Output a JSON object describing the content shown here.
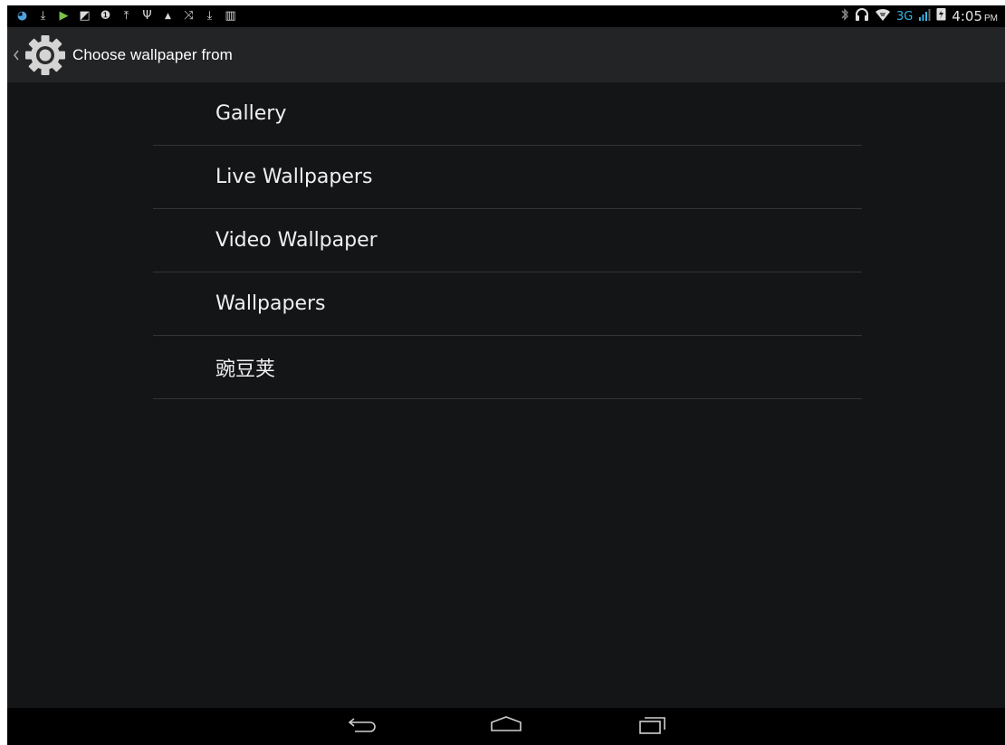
{
  "status_bar": {
    "left_icons": [
      {
        "name": "notification-app-icon",
        "glyph": "◕"
      },
      {
        "name": "download-icon",
        "glyph": "⤓"
      },
      {
        "name": "play-store-icon",
        "glyph": "▶"
      },
      {
        "name": "image-icon",
        "glyph": "◩"
      },
      {
        "name": "alert-icon",
        "glyph": "❶"
      },
      {
        "name": "upload-icon",
        "glyph": "⤒"
      },
      {
        "name": "usb-icon",
        "glyph": "Ψ"
      },
      {
        "name": "lock-icon",
        "glyph": "▲"
      },
      {
        "name": "missed-call-icon",
        "glyph": "⤨"
      },
      {
        "name": "download-icon",
        "glyph": "⤓"
      },
      {
        "name": "barcode-icon",
        "glyph": "▥"
      }
    ],
    "network_label": "3G",
    "time": "4:05",
    "ampm": "PM",
    "accent_color": "#33b5e5"
  },
  "action_bar": {
    "title": "Choose wallpaper from",
    "up_icon": "chevron-left-icon",
    "app_icon": "gear-icon"
  },
  "list": {
    "items": [
      {
        "label": "Gallery"
      },
      {
        "label": "Live Wallpapers"
      },
      {
        "label": "Video Wallpaper"
      },
      {
        "label": "Wallpapers"
      },
      {
        "label": "豌豆荚"
      }
    ]
  },
  "nav_bar": {
    "buttons": [
      "back-icon",
      "home-icon",
      "recents-icon"
    ]
  }
}
